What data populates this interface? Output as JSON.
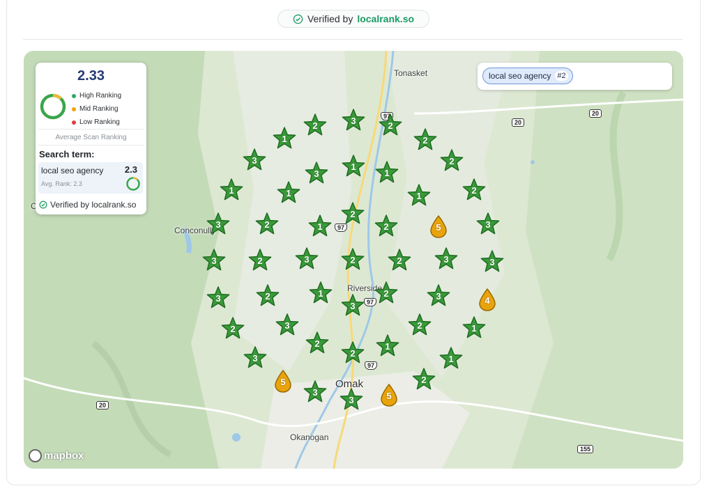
{
  "header": {
    "verified_prefix": "Verified by",
    "verified_brand": "localrank.so"
  },
  "stats": {
    "average": "2.33",
    "legend": [
      {
        "label": "High Ranking",
        "color": "#2fa866"
      },
      {
        "label": "Mid Ranking",
        "color": "#f0a500"
      },
      {
        "label": "Low Ranking",
        "color": "#d94040"
      }
    ],
    "average_label": "Average Scan Ranking",
    "search_term_heading": "Search term:",
    "term": "local seo agency",
    "term_rank": "2.3",
    "term_avg": "Avg. Rank: 2.3",
    "footer": "Verified by localrank.so"
  },
  "keyword_chip": {
    "label": "local seo agency",
    "rank": "#2"
  },
  "map": {
    "attribution": "mapbox",
    "places": [
      "Tonasket",
      "Conconully",
      "Riverside",
      "Omak",
      "Okanogan",
      "O"
    ],
    "route_shields": [
      "20",
      "20",
      "20",
      "97",
      "97",
      "97",
      "97",
      "155",
      "97"
    ],
    "high_color": "#3a9a3a",
    "mid_color": "#e9a40d"
  },
  "markers": [
    {
      "rank": "1",
      "kind": "star"
    },
    {
      "rank": "2",
      "kind": "star"
    },
    {
      "rank": "3",
      "kind": "star"
    },
    {
      "rank": "2",
      "kind": "star"
    },
    {
      "rank": "2",
      "kind": "star"
    },
    {
      "rank": "3",
      "kind": "star"
    },
    {
      "rank": "3",
      "kind": "star"
    },
    {
      "rank": "1",
      "kind": "star"
    },
    {
      "rank": "1",
      "kind": "star"
    },
    {
      "rank": "2",
      "kind": "star"
    },
    {
      "rank": "1",
      "kind": "star"
    },
    {
      "rank": "1",
      "kind": "star"
    },
    {
      "rank": "1",
      "kind": "star"
    },
    {
      "rank": "2",
      "kind": "star"
    },
    {
      "rank": "3",
      "kind": "star"
    },
    {
      "rank": "2",
      "kind": "star"
    },
    {
      "rank": "1",
      "kind": "star"
    },
    {
      "rank": "2",
      "kind": "star"
    },
    {
      "rank": "2",
      "kind": "star"
    },
    {
      "rank": "5",
      "kind": "drop"
    },
    {
      "rank": "3",
      "kind": "star"
    },
    {
      "rank": "3",
      "kind": "star"
    },
    {
      "rank": "2",
      "kind": "star"
    },
    {
      "rank": "3",
      "kind": "star"
    },
    {
      "rank": "2",
      "kind": "star"
    },
    {
      "rank": "2",
      "kind": "star"
    },
    {
      "rank": "3",
      "kind": "star"
    },
    {
      "rank": "3",
      "kind": "star"
    },
    {
      "rank": "3",
      "kind": "star"
    },
    {
      "rank": "2",
      "kind": "star"
    },
    {
      "rank": "1",
      "kind": "star"
    },
    {
      "rank": "3",
      "kind": "star"
    },
    {
      "rank": "2",
      "kind": "star"
    },
    {
      "rank": "3",
      "kind": "star"
    },
    {
      "rank": "4",
      "kind": "drop"
    },
    {
      "rank": "2",
      "kind": "star"
    },
    {
      "rank": "3",
      "kind": "star"
    },
    {
      "rank": "2",
      "kind": "star"
    },
    {
      "rank": "2",
      "kind": "star"
    },
    {
      "rank": "1",
      "kind": "star"
    },
    {
      "rank": "2",
      "kind": "star"
    },
    {
      "rank": "1",
      "kind": "star"
    },
    {
      "rank": "3",
      "kind": "star"
    },
    {
      "rank": "5",
      "kind": "drop"
    },
    {
      "rank": "3",
      "kind": "star"
    },
    {
      "rank": "3",
      "kind": "star"
    },
    {
      "rank": "5",
      "kind": "drop"
    },
    {
      "rank": "2",
      "kind": "star"
    },
    {
      "rank": "1",
      "kind": "star"
    }
  ]
}
